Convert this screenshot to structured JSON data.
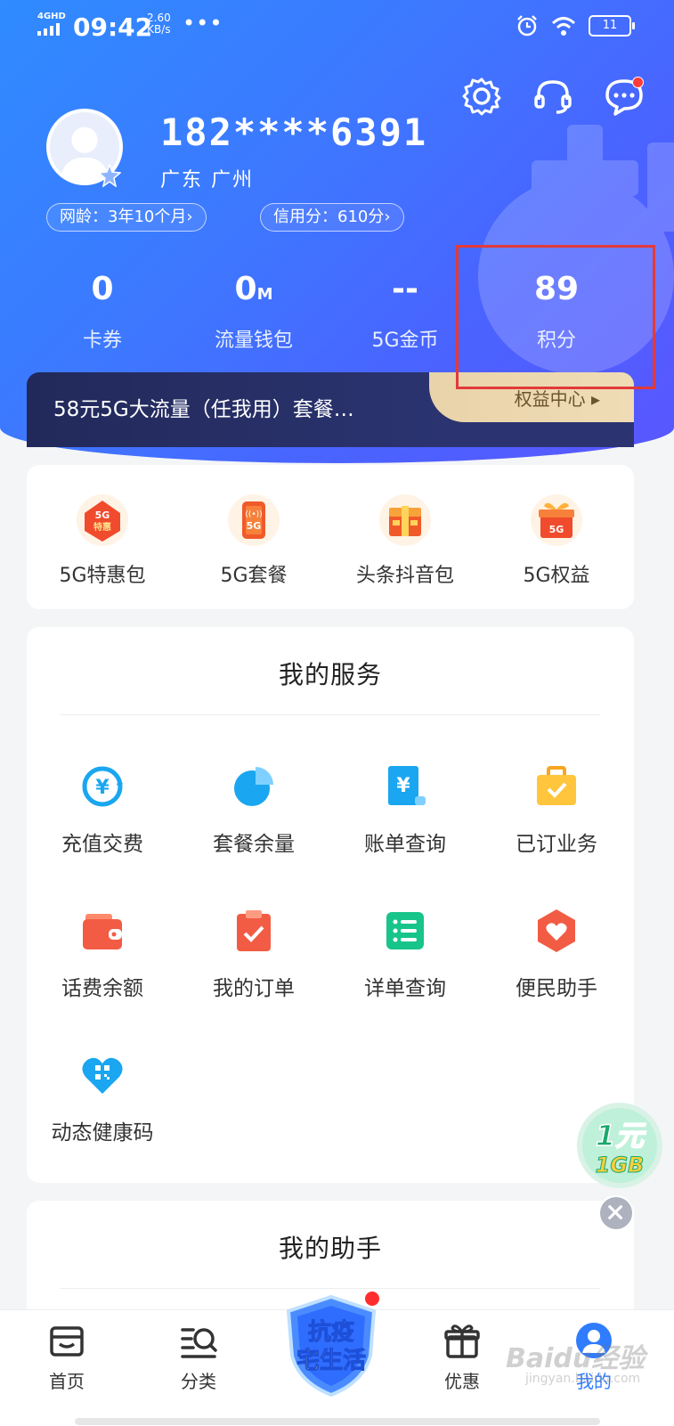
{
  "statusbar": {
    "network": "4GHD",
    "time": "09:42",
    "speed_value": "2.60",
    "speed_unit": "KB/s",
    "dots": "•••",
    "battery": "11"
  },
  "header": {
    "phone": "182****6391",
    "location": "广东  广州",
    "network_age": "网龄：3年10个月",
    "credit_score": "信用分：610分",
    "chevron": "›"
  },
  "stats": [
    {
      "value": "0",
      "unit": "",
      "label": "卡券"
    },
    {
      "value": "0",
      "unit": "M",
      "label": "流量钱包"
    },
    {
      "value": "--",
      "unit": "",
      "label": "5G金币"
    },
    {
      "value": "89",
      "unit": "",
      "label": "积分"
    }
  ],
  "plan": {
    "name": "58元5G大流量（任我用）套餐…",
    "rights_center": "权益中心 ▸"
  },
  "five_g": [
    {
      "label": "5G特惠包",
      "icon": "5g-discount-icon"
    },
    {
      "label": "5G套餐",
      "icon": "5g-plan-icon"
    },
    {
      "label": "头条抖音包",
      "icon": "toutiao-douyin-icon"
    },
    {
      "label": "5G权益",
      "icon": "5g-gift-icon"
    }
  ],
  "services": {
    "title": "我的服务",
    "items": [
      {
        "label": "充值交费",
        "icon": "recharge-icon"
      },
      {
        "label": "套餐余量",
        "icon": "pie-chart-icon"
      },
      {
        "label": "账单查询",
        "icon": "bill-icon"
      },
      {
        "label": "已订业务",
        "icon": "briefcase-icon"
      },
      {
        "label": "话费余额",
        "icon": "wallet-icon"
      },
      {
        "label": "我的订单",
        "icon": "clipboard-check-icon"
      },
      {
        "label": "详单查询",
        "icon": "list-icon"
      },
      {
        "label": "便民助手",
        "icon": "heart-hexagon-icon"
      },
      {
        "label": "动态健康码",
        "icon": "health-code-icon"
      }
    ]
  },
  "assistant": {
    "title": "我的助手"
  },
  "promo": {
    "line1": "1元",
    "line2": "1GB"
  },
  "nav": {
    "home": "首页",
    "category": "分类",
    "promo_line1": "抗疫",
    "promo_line2": "宅生活",
    "offers": "优惠",
    "mine": "我的"
  },
  "watermark": {
    "text": "Baidu经验",
    "sub": "jingyan.baidu.com"
  },
  "colors": {
    "brand_blue": "#2f7cff",
    "highlight_red": "#e23a3a",
    "plan_bar": "#2b3470",
    "gold": "#e9d3a9"
  }
}
